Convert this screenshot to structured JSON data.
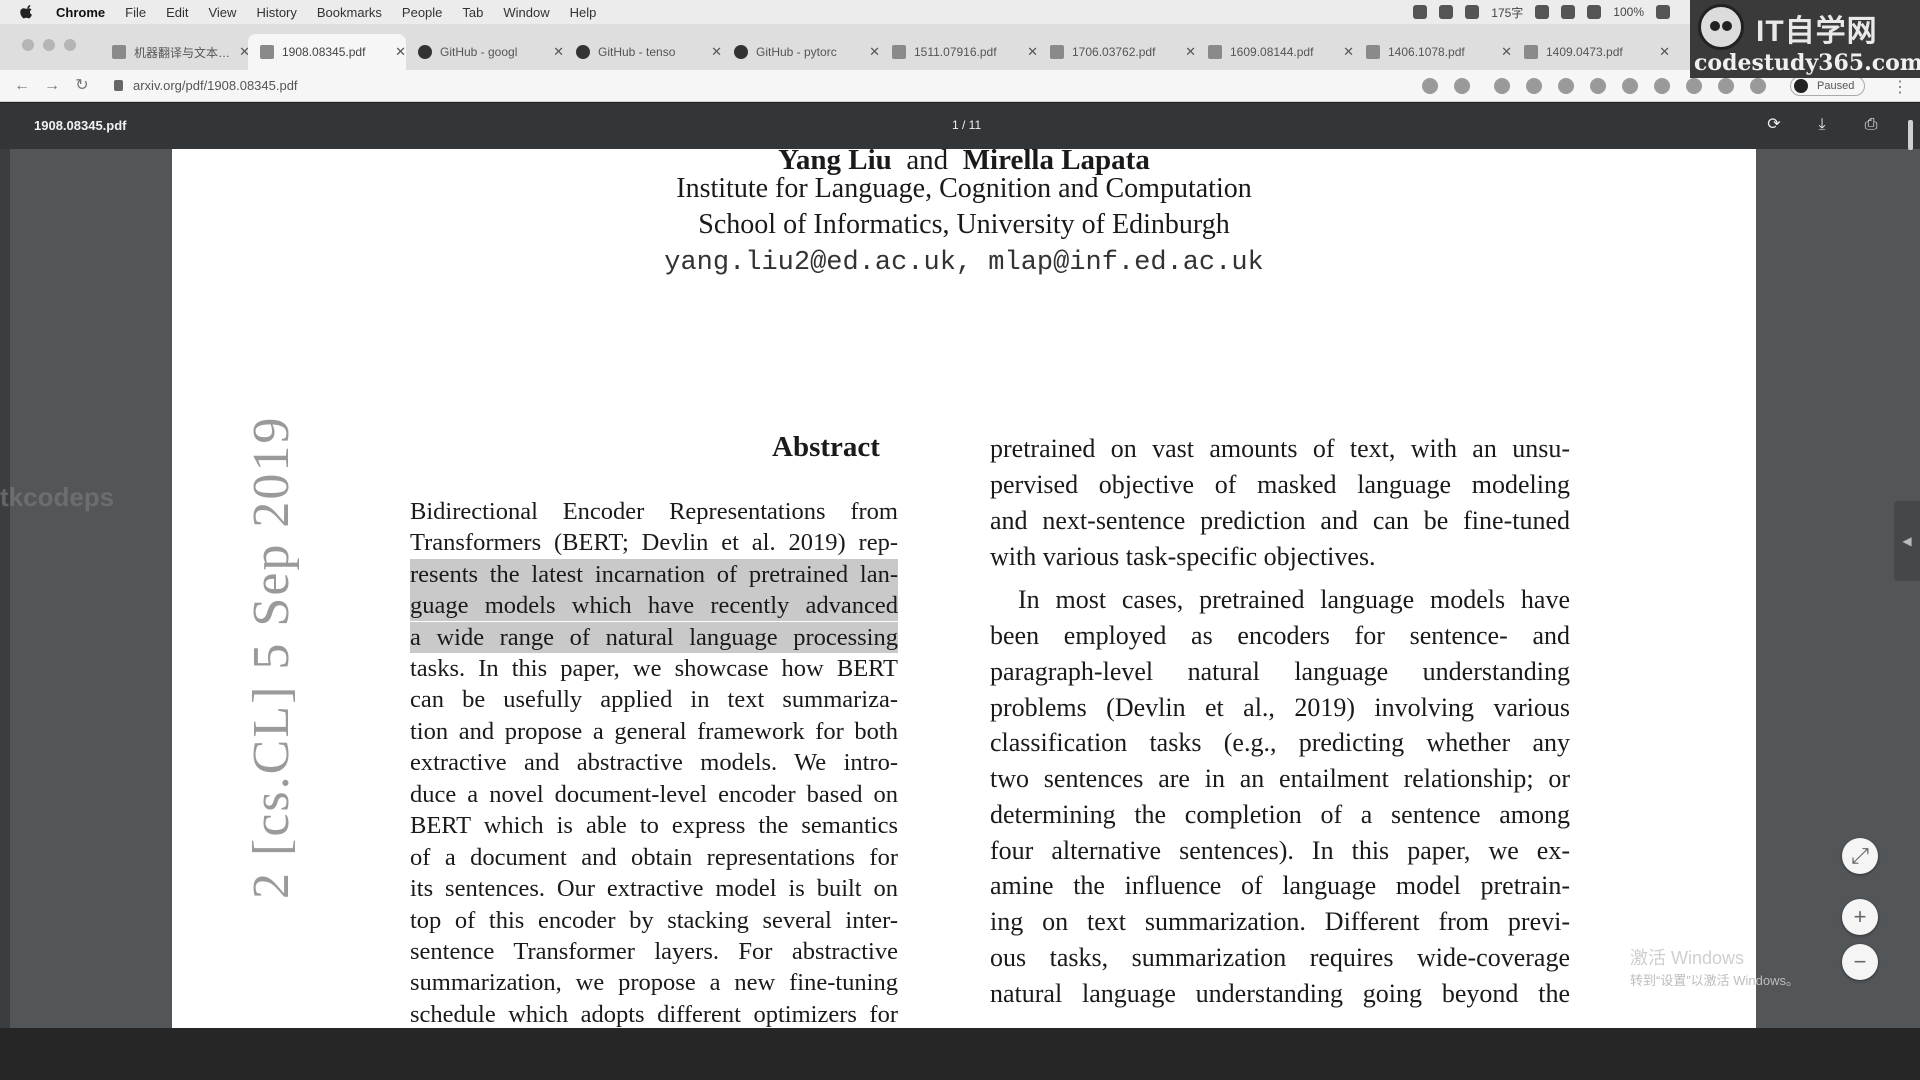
{
  "menubar": {
    "items": [
      "Chrome",
      "File",
      "Edit",
      "View",
      "History",
      "Bookmarks",
      "People",
      "Tab",
      "Window",
      "Help"
    ],
    "status": [
      "175字",
      "100%"
    ]
  },
  "brand": {
    "title": "IT自学网",
    "url": "codestudy365.com"
  },
  "tabs": [
    {
      "label": "机器翻译与文本…",
      "icon": "doc"
    },
    {
      "label": "1908.08345.pdf",
      "icon": "pdf",
      "active": true
    },
    {
      "label": "GitHub - googl",
      "icon": "github"
    },
    {
      "label": "GitHub - tenso",
      "icon": "github"
    },
    {
      "label": "GitHub - pytorc",
      "icon": "github"
    },
    {
      "label": "1511.07916.pdf",
      "icon": "pdf"
    },
    {
      "label": "1706.03762.pdf",
      "icon": "pdf"
    },
    {
      "label": "1609.08144.pdf",
      "icon": "pdf"
    },
    {
      "label": "1406.1078.pdf",
      "icon": "pdf"
    },
    {
      "label": "1409.0473.pdf",
      "icon": "pdf"
    }
  ],
  "toolbar": {
    "url": "arxiv.org/pdf/1908.08345.pdf",
    "profile_status": "Paused"
  },
  "viewer": {
    "filename": "1908.08345.pdf",
    "page_indicator": "1 / 11"
  },
  "paper": {
    "authors_a": "Yang Liu",
    "authors_and": "and",
    "authors_b": "Mirella Lapata",
    "affiliation1": "Institute for Language, Cognition and Computation",
    "affiliation2": "School of Informatics, University of Edinburgh",
    "emails": "yang.liu2@ed.ac.uk, mlap@inf.ed.ac.uk",
    "abstract_title": "Abstract",
    "arxiv_stamp": "2 [cs.CL] 5 Sep 2019",
    "abstract_lines": [
      "Bidirectional Encoder Representations from",
      "Transformers (BERT; Devlin et al. 2019) rep-",
      "resents the latest incarnation of pretrained lan-",
      "guage models which have recently advanced",
      "a wide range of natural language processing",
      "tasks. In this paper, we showcase how BERT",
      "can be usefully applied in text summariza-",
      "tion and propose a general framework for both",
      "extractive and abstractive models. We intro-",
      "duce a novel document-level encoder based on",
      "BERT which is able to express the semantics",
      "of a document and obtain representations for",
      "its sentences. Our extractive model is built on",
      "top of this encoder by stacking several inter-",
      "sentence Transformer layers. For abstractive",
      "summarization, we propose a new fine-tuning",
      "schedule which adopts different optimizers for"
    ],
    "col2_lines": [
      "pretrained on vast amounts of text, with an unsu-",
      "pervised objective of masked language modeling",
      "and next-sentence prediction and can be fine-tuned",
      "with various task-specific objectives.",
      "In most cases, pretrained language models have",
      "been employed as encoders for sentence- and",
      "paragraph-level natural language understanding",
      "problems (Devlin et al., 2019) involving various",
      "classification tasks (e.g., predicting whether any",
      "two sentences are in an entailment relationship; or",
      "determining the completion of a sentence among",
      "four alternative sentences). In this paper, we ex-",
      "amine the influence of language model pretrain-",
      "ing on text summarization. Different from previ-",
      "ous tasks, summarization requires wide-coverage",
      "natural language understanding going beyond the"
    ]
  },
  "overlays": {
    "left_watermark": "tkcodeps",
    "windows_activation": "激活 Windows",
    "windows_activation_sub": "转到“设置”以激活 Windows。"
  },
  "colors": {
    "highlight": "#c9c9c9",
    "viewer_bg": "#525659",
    "viewer_header": "#323639"
  }
}
